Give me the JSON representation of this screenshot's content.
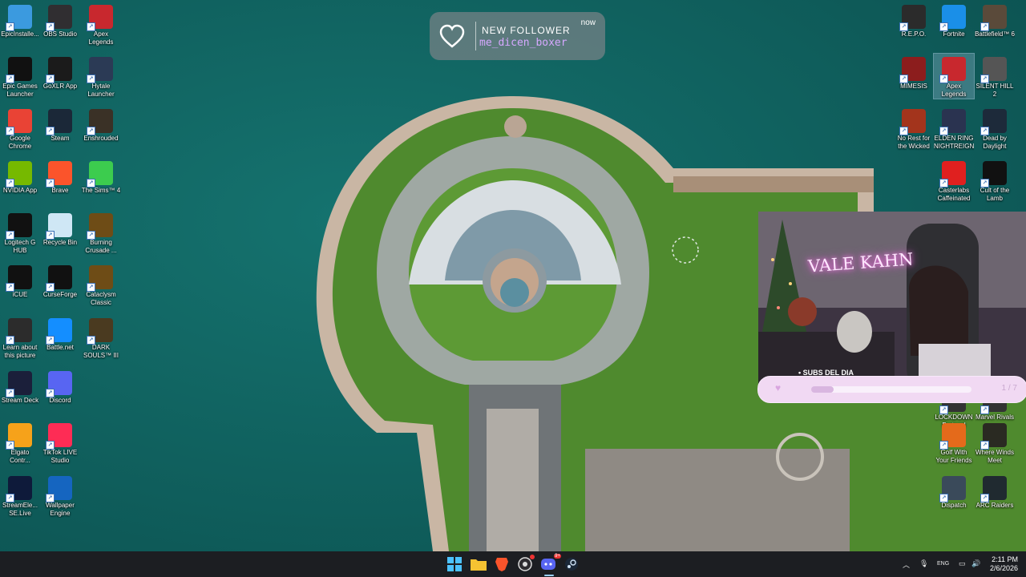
{
  "desktop_icons_left": [
    {
      "label": "EpicInstalle...",
      "icon": "installer-icon",
      "color": "#3b9adf"
    },
    {
      "label": "OBS Studio",
      "icon": "obs-icon",
      "color": "#302e31"
    },
    {
      "label": "Apex Legends",
      "icon": "apex-icon",
      "color": "#c8282e"
    },
    {
      "label": "Epic Games Launcher",
      "icon": "epic-icon",
      "color": "#111111"
    },
    {
      "label": "GoXLR App",
      "icon": "goxlr-icon",
      "color": "#1b1b1b"
    },
    {
      "label": "Hytale Launcher",
      "icon": "hytale-icon",
      "color": "#2b3a55"
    },
    {
      "label": "Google Chrome",
      "icon": "chrome-icon",
      "color": "#e94335"
    },
    {
      "label": "Steam",
      "icon": "steam-icon",
      "color": "#1b2838"
    },
    {
      "label": "Enshrouded",
      "icon": "enshrouded-icon",
      "color": "#3a3126"
    },
    {
      "label": "NVIDIA App",
      "icon": "nvidia-icon",
      "color": "#76b900"
    },
    {
      "label": "Brave",
      "icon": "brave-icon",
      "color": "#fb542b"
    },
    {
      "label": "The Sims™ 4",
      "icon": "sims-icon",
      "color": "#3ccc4e"
    },
    {
      "label": "Logitech G HUB",
      "icon": "logitech-icon",
      "color": "#111111"
    },
    {
      "label": "Recycle Bin",
      "icon": "recycle-bin-icon",
      "color": "#cfe7f5"
    },
    {
      "label": "Burning Crusade ...",
      "icon": "wow-icon",
      "color": "#6e4c16"
    },
    {
      "label": "iCUE",
      "icon": "icue-icon",
      "color": "#111111"
    },
    {
      "label": "CurseForge",
      "icon": "curseforge-icon",
      "color": "#111111"
    },
    {
      "label": "Cataclysm Classic",
      "icon": "wow-cataclysm-icon",
      "color": "#6e4c16"
    },
    {
      "label": "Learn about this picture",
      "icon": "spotlight-icon",
      "color": "#2c2c2c"
    },
    {
      "label": "Battle.net",
      "icon": "battlenet-icon",
      "color": "#148eff"
    },
    {
      "label": "DARK SOULS™ III",
      "icon": "darksouls-icon",
      "color": "#4a3a20"
    },
    {
      "label": "Stream Deck",
      "icon": "streamdeck-icon",
      "color": "#1b1f3a"
    },
    {
      "label": "Discord",
      "icon": "discord-icon",
      "color": "#5865f2"
    },
    {
      "label": "Elgato Contr...",
      "icon": "elgato-icon",
      "color": "#f6a21a"
    },
    {
      "label": "TikTok LIVE Studio",
      "icon": "tiktok-icon",
      "color": "#fe2c55"
    },
    {
      "label": "StreamEle... SE.Live",
      "icon": "streamelements-icon",
      "color": "#0e1a3a"
    },
    {
      "label": "Wallpaper Engine",
      "icon": "wallpaper-engine-icon",
      "color": "#1565c0"
    }
  ],
  "desktop_icons_right": [
    {
      "label": "R.E.P.O.",
      "icon": "repo-icon",
      "color": "#2b2b2b"
    },
    {
      "label": "Fortnite",
      "icon": "fortnite-icon",
      "color": "#1a8fe8"
    },
    {
      "label": "Battlefield™ 6",
      "icon": "battlefield-icon",
      "color": "#5a4a3a"
    },
    {
      "label": "MIMESIS",
      "icon": "mimesis-icon",
      "color": "#8c1d1d"
    },
    {
      "label": "Apex Legends",
      "icon": "apex-icon",
      "color": "#c8282e"
    },
    {
      "label": "SILENT HILL 2",
      "icon": "silenthill-icon",
      "color": "#555555"
    },
    {
      "label": "No Rest for the Wicked",
      "icon": "norest-icon",
      "color": "#a3341c"
    },
    {
      "label": "ELDEN RING NIGHTREIGN",
      "icon": "eldenring-icon",
      "color": "#2a3350"
    },
    {
      "label": "Dead by Daylight",
      "icon": "dbd-icon",
      "color": "#1d2a3a"
    },
    {
      "label": "Casterlabs Caffeinated",
      "icon": "casterlabs-icon",
      "color": "#e0201f"
    },
    {
      "label": "Cult of the Lamb",
      "icon": "cultofthelamb-icon",
      "color": "#111111"
    },
    {
      "label": "LOCKDOWN Protocol",
      "icon": "lockdown-icon",
      "color": "#333333"
    },
    {
      "label": "Marvel Rivals",
      "icon": "marvelrivals-icon",
      "color": "#333333"
    },
    {
      "label": "Golf With Your Friends",
      "icon": "golf-icon",
      "color": "#e46a1b"
    },
    {
      "label": "Where Winds Meet",
      "icon": "wherewinds-icon",
      "color": "#2a2a22"
    },
    {
      "label": "Dispatch",
      "icon": "dispatch-icon",
      "color": "#3a4a5a"
    },
    {
      "label": "ARC Raiders",
      "icon": "arcraiders-icon",
      "color": "#202a30"
    }
  ],
  "notification": {
    "title": "NEW FOLLOWER",
    "username": "me_dicen_boxer",
    "time": "now",
    "username_color": "#d6a8ff"
  },
  "overlay": {
    "subs_title": "SUBS DEL DIA",
    "counter": "1 / 7",
    "progress": 0.14,
    "neon_sign": "VALE KAHN"
  },
  "taskbar": {
    "items": [
      "windows-start-icon",
      "file-explorer-icon",
      "brave-icon",
      "obs-icon",
      "discord-icon",
      "steam-icon"
    ],
    "discord_badge": "9+",
    "language": "ENG",
    "time": "2:11 PM",
    "date": "2/6/2026"
  }
}
